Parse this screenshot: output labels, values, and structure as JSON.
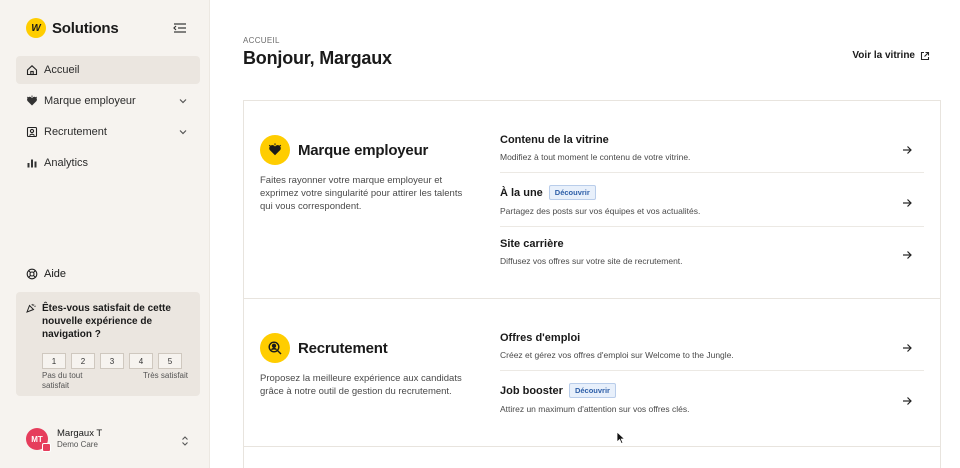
{
  "brand": {
    "logo_text": "W",
    "name": "Solutions"
  },
  "sidebar": {
    "nav": [
      {
        "label": "Accueil",
        "icon": "home-icon",
        "active": true
      },
      {
        "label": "Marque employeur",
        "icon": "heart-icon",
        "expandable": true
      },
      {
        "label": "Recrutement",
        "icon": "recruitment-icon",
        "expandable": true
      },
      {
        "label": "Analytics",
        "icon": "bar-chart-icon"
      }
    ],
    "help_label": "Aide",
    "survey": {
      "question": "Êtes-vous satisfait de cette nouvelle expérience de navigation ?",
      "scale": [
        "1",
        "2",
        "3",
        "4",
        "5"
      ],
      "min_label": "Pas du tout satisfait",
      "max_label": "Très satisfait"
    },
    "user": {
      "initials": "MT",
      "name": "Margaux T",
      "company": "Demo Care",
      "avatar_color": "#e63d5c"
    }
  },
  "main": {
    "breadcrumb": "ACCUEIL",
    "title": "Bonjour, Margaux",
    "showcase_link": "Voir la vitrine",
    "accent_color": "#ffcd00",
    "sections": [
      {
        "title": "Marque employeur",
        "icon": "heart-icon",
        "description": "Faites rayonner votre marque employeur et exprimez votre singularité pour attirer les talents qui vous correspondent.",
        "links": [
          {
            "title": "Contenu de la vitrine",
            "description": "Modifiez à tout moment le contenu de votre vitrine.",
            "badge": ""
          },
          {
            "title": "À la une",
            "description": "Partagez des posts sur vos équipes et vos actualités.",
            "badge": "Découvrir"
          },
          {
            "title": "Site carrière",
            "description": "Diffusez vos offres sur votre site de recrutement.",
            "badge": ""
          }
        ]
      },
      {
        "title": "Recrutement",
        "icon": "search-person-icon",
        "description": "Proposez la meilleure expérience aux candidats grâce à notre outil de gestion du recrutement.",
        "links": [
          {
            "title": "Offres d'emploi",
            "description": "Créez et gérez vos offres d'emploi sur Welcome to the Jungle.",
            "badge": ""
          },
          {
            "title": "Job booster",
            "description": "Attirez un maximum d'attention sur vos offres clés.",
            "badge": "Découvrir"
          }
        ]
      }
    ]
  }
}
